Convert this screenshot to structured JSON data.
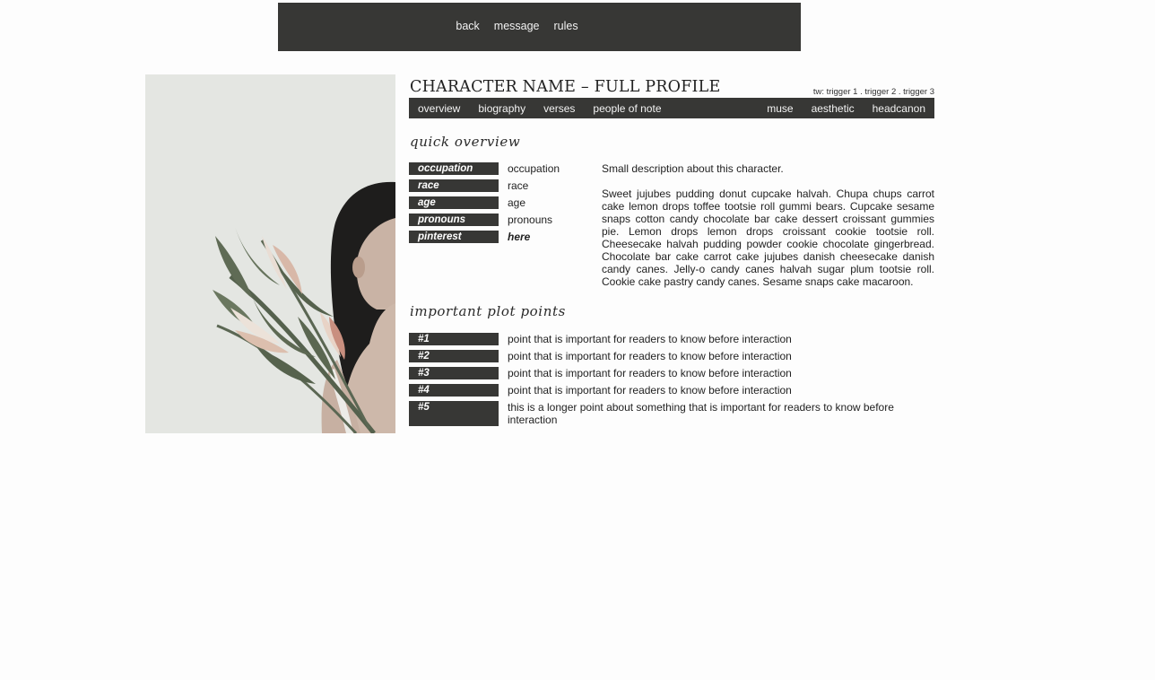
{
  "topnav": [
    "back",
    "message",
    "rules"
  ],
  "header": {
    "title": "CHARACTER NAME – FULL PROFILE",
    "triggers": "tw: trigger 1 . trigger 2 . trigger 3"
  },
  "tabs_left": [
    "overview",
    "biography",
    "verses",
    "people of note"
  ],
  "tabs_right": [
    "muse",
    "aesthetic",
    "headcanon"
  ],
  "overview": {
    "title": "quick overview",
    "facts": [
      {
        "label": "occupation",
        "value": "occupation"
      },
      {
        "label": "race",
        "value": "race"
      },
      {
        "label": "age",
        "value": "age"
      },
      {
        "label": "pronouns",
        "value": "pronouns"
      },
      {
        "label": "pinterest",
        "value": "here"
      }
    ],
    "short_description": "Small description about this character.",
    "long_description": "Sweet jujubes pudding donut cupcake halvah. Chupa chups carrot cake lemon drops toffee tootsie roll gummi bears. Cupcake sesame snaps cotton candy chocolate bar cake dessert croissant gummies pie. Lemon drops lemon drops croissant cookie tootsie roll. Cheesecake halvah pudding powder cookie chocolate gingerbread. Chocolate bar cake carrot cake jujubes danish cheesecake danish candy canes. Jelly-o candy canes halvah sugar plum tootsie roll. Cookie cake pastry candy canes. Sesame snaps cake macaroon."
  },
  "plot": {
    "title": "important plot points",
    "points": [
      {
        "label": "#1",
        "text": "point that is important for readers to know before interaction"
      },
      {
        "label": "#2",
        "text": "point that is important for readers to know before interaction"
      },
      {
        "label": "#3",
        "text": "point that is important for readers to know before interaction"
      },
      {
        "label": "#4",
        "text": "point that is important for readers to know before interaction"
      },
      {
        "label": "#5",
        "text": "this is a longer point about something that is important for readers to know before interaction"
      }
    ]
  },
  "colors": {
    "bar": "#373735",
    "background": "#fdfdfd"
  }
}
